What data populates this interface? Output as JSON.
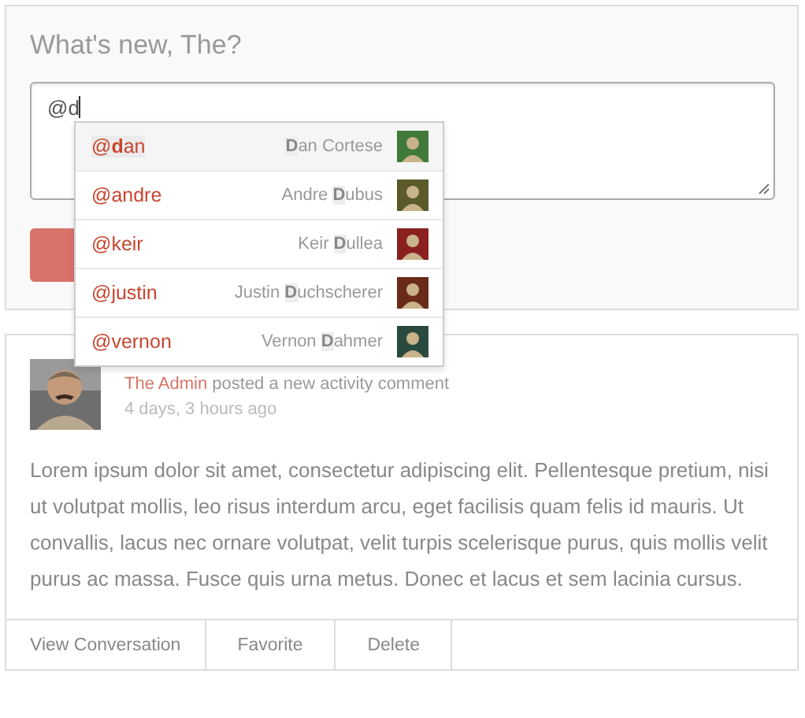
{
  "composer": {
    "prompt": "What's new, The?",
    "value": "@d"
  },
  "mentions": [
    {
      "handle": "@**d**an",
      "name_match": "D",
      "name_after": "an Cortese",
      "color": "#3f7a3a",
      "selected": true
    },
    {
      "handle": "@andre",
      "name_before": "Andre ",
      "name_match": "D",
      "name_after": "ubus",
      "color": "#5a5a2a",
      "selected": false
    },
    {
      "handle": "@keir",
      "name_before": "Keir ",
      "name_match": "D",
      "name_after": "ullea",
      "color": "#8a2020",
      "selected": false
    },
    {
      "handle": "@justin",
      "name_before": "Justin ",
      "name_match": "D",
      "name_after": "uchscherer",
      "color": "#6a2a1a",
      "selected": false
    },
    {
      "handle": "@vernon",
      "name_before": "Vernon ",
      "name_match": "D",
      "name_after": "ahmer",
      "color": "#2a4a40",
      "selected": false
    }
  ],
  "activity": {
    "author": "The Admin",
    "action": "posted a new activity comment",
    "time": "4 days, 3 hours ago",
    "body": "Lorem ipsum dolor sit amet, consectetur adipiscing elit. Pellentesque pretium, nisi ut volutpat mollis, leo risus interdum arcu, eget facilisis quam felis id mauris. Ut convallis, lacus nec ornare volutpat, velit turpis scelerisque purus, quis mollis velit purus ac massa. Fusce quis urna metus. Donec et lacus et sem lacinia cursus.",
    "actions": [
      "View Conversation",
      "Favorite",
      "Delete"
    ]
  }
}
